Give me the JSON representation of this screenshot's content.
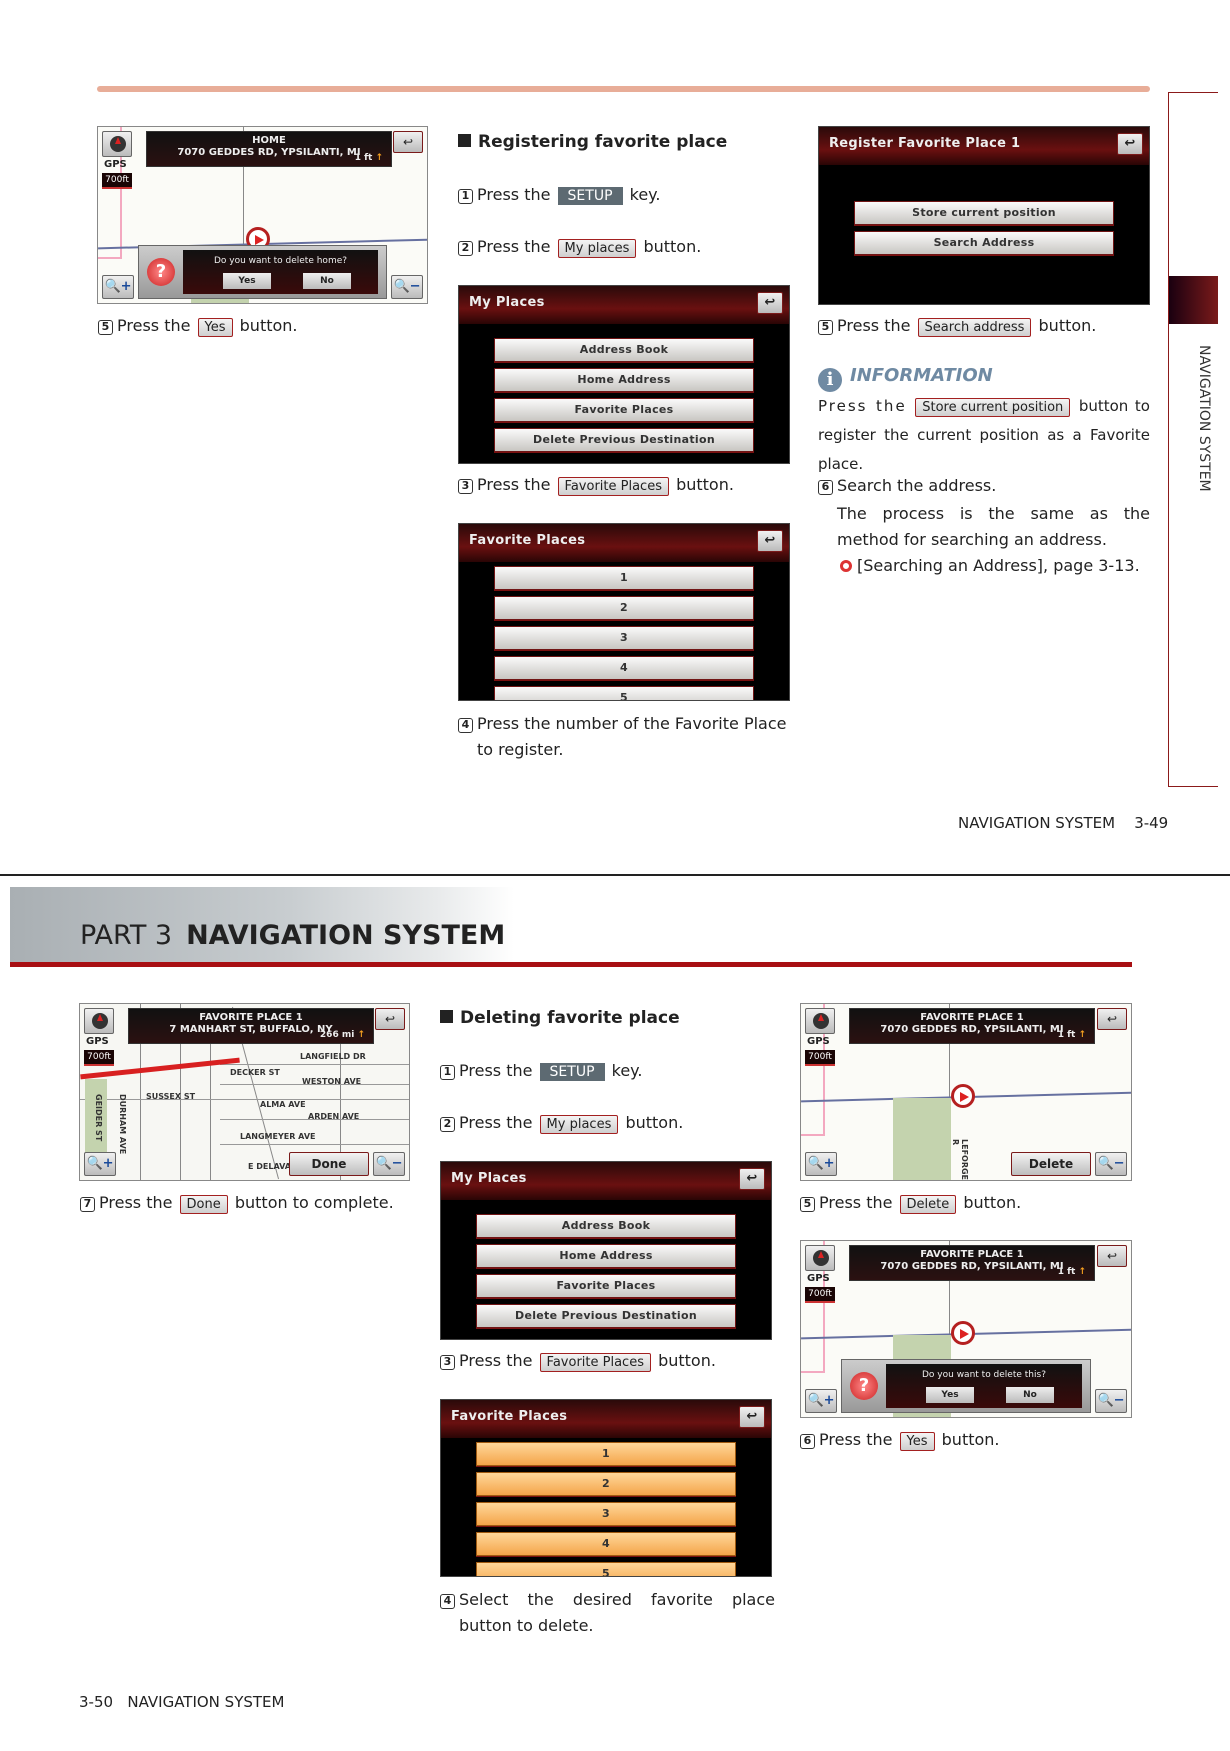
{
  "top_page": {
    "page_label": "NAVIGATION SYSTEM",
    "page_number": "3-49",
    "side_tab": "NAVIGATION SYSTEM",
    "col1": {
      "screen": {
        "header_title": "HOME",
        "header_address": "7070 GEDDES RD, YPSILANTI, MI",
        "distance": "1 ft",
        "gps_label": "GPS",
        "scale": "700ft",
        "dialog_text": "Do you want to delete home?",
        "dialog_yes": "Yes",
        "dialog_no": "No"
      },
      "step5": {
        "num": "5",
        "pre": "Press the",
        "ref": "Yes",
        "post": "button."
      }
    },
    "col2": {
      "heading": "Registering favorite place",
      "step1": {
        "num": "1",
        "pre": "Press the",
        "key": "SETUP",
        "post": "key."
      },
      "step2": {
        "num": "2",
        "pre": "Press the",
        "ref": "My places",
        "post": "button."
      },
      "my_places_screen": {
        "title": "My Places",
        "buttons": [
          "Address Book",
          "Home Address",
          "Favorite Places",
          "Delete Previous Destination"
        ]
      },
      "step3": {
        "num": "3",
        "pre": "Press the",
        "ref": "Favorite Places",
        "post": "button."
      },
      "favorites_screen": {
        "title": "Favorite Places",
        "buttons": [
          "1",
          "2",
          "3",
          "4",
          "5"
        ]
      },
      "step4": {
        "num": "4",
        "text": "Press the number of the Favorite Place to register."
      }
    },
    "col3": {
      "register_screen": {
        "title": "Register Favorite Place 1",
        "buttons": [
          "Store current position",
          "Search Address"
        ]
      },
      "step5": {
        "num": "5",
        "pre": "Press the",
        "ref": "Search address",
        "post": "button."
      },
      "info": {
        "title": "INFORMATION",
        "pre": "Press the",
        "ref": "Store current position",
        "post": "button to register the current position as a Favorite place."
      },
      "step6": {
        "num": "6",
        "text": "Search the address.",
        "detail": "The process is the same as the method for searching an address.",
        "reference": "[Searching an Address], page 3-13."
      }
    }
  },
  "bottom_page": {
    "part_label": "PART 3",
    "part_title": "NAVIGATION SYSTEM",
    "page_number": "3-50",
    "page_label": "NAVIGATION SYSTEM",
    "col1": {
      "screen": {
        "header_title": "FAVORITE PLACE 1",
        "header_address": "7 MANHART ST, BUFFALO, NY",
        "distance": "266 mi",
        "gps_label": "GPS",
        "scale": "700ft",
        "streets": [
          "LANGFIELD DR",
          "DECKER ST",
          "WESTON AVE",
          "SUSSEX ST",
          "ALMA AVE",
          "ARDEN AVE",
          "LANGMEYER AVE",
          "E DELAVA",
          "GEIDER ST",
          "DURHAM AVE"
        ],
        "action_button": "Done"
      },
      "step7": {
        "num": "7",
        "pre": "Press the",
        "ref": "Done",
        "post": "button to complete."
      }
    },
    "col2": {
      "heading": "Deleting favorite place",
      "step1": {
        "num": "1",
        "pre": "Press the",
        "key": "SETUP",
        "post": "key."
      },
      "step2": {
        "num": "2",
        "pre": "Press the",
        "ref": "My places",
        "post": "button."
      },
      "my_places_screen": {
        "title": "My Places",
        "buttons": [
          "Address Book",
          "Home Address",
          "Favorite Places",
          "Delete Previous Destination"
        ]
      },
      "step3": {
        "num": "3",
        "pre": "Press the",
        "ref": "Favorite Places",
        "post": "button."
      },
      "favorites_screen": {
        "title": "Favorite Places",
        "buttons": [
          "1",
          "2",
          "3",
          "4",
          "5"
        ]
      },
      "step4": {
        "num": "4",
        "text": "Select the desired favorite place button to delete."
      }
    },
    "col3": {
      "screen1": {
        "header_title": "FAVORITE PLACE 1",
        "header_address": "7070 GEDDES RD, YPSILANTI, MI",
        "distance": "1 ft",
        "gps_label": "GPS",
        "scale": "700ft",
        "street": "LEFORGE R",
        "action_button": "Delete"
      },
      "step5": {
        "num": "5",
        "pre": "Press the",
        "ref": "Delete",
        "post": "button."
      },
      "screen2": {
        "header_title": "FAVORITE PLACE 1",
        "header_address": "7070 GEDDES RD, YPSILANTI, MI",
        "distance": "1 ft",
        "gps_label": "GPS",
        "scale": "700ft",
        "dialog_text": "Do you want to delete this?",
        "dialog_yes": "Yes",
        "dialog_no": "No"
      },
      "step6": {
        "num": "6",
        "pre": "Press the",
        "ref": "Yes",
        "post": "button."
      }
    }
  }
}
